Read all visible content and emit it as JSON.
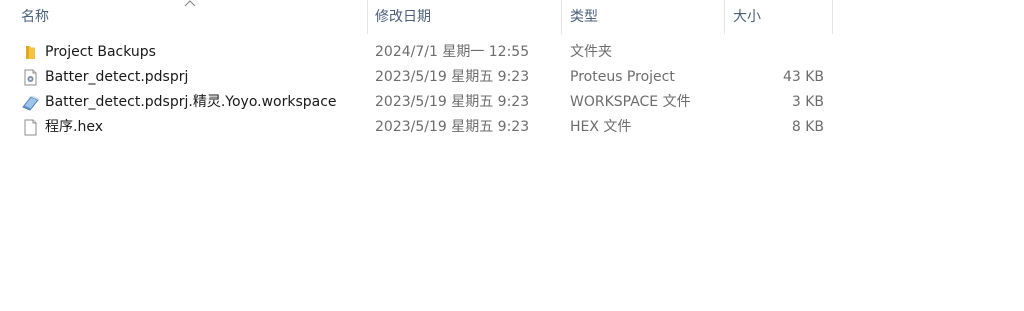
{
  "columns": {
    "name": "名称",
    "date": "修改日期",
    "type": "类型",
    "size": "大小"
  },
  "files": [
    {
      "name": "Project Backups",
      "date": "2024/7/1 星期一 12:55",
      "type": "文件夹",
      "size": "",
      "icon": "folder-icon"
    },
    {
      "name": "Batter_detect.pdsprj",
      "date": "2023/5/19 星期五 9:23",
      "type": "Proteus Project",
      "size": "43 KB",
      "icon": "proteus-project-icon"
    },
    {
      "name": "Batter_detect.pdsprj.精灵.Yoyo.workspace",
      "date": "2023/5/19 星期五 9:23",
      "type": "WORKSPACE 文件",
      "size": "3 KB",
      "icon": "workspace-file-icon"
    },
    {
      "name": "程序.hex",
      "date": "2023/5/19 星期五 9:23",
      "type": "HEX 文件",
      "size": "8 KB",
      "icon": "blank-file-icon"
    }
  ],
  "colors": {
    "header_text": "#4c607a",
    "folder": "#f5c242",
    "secondary_text": "#6d6d6d"
  }
}
